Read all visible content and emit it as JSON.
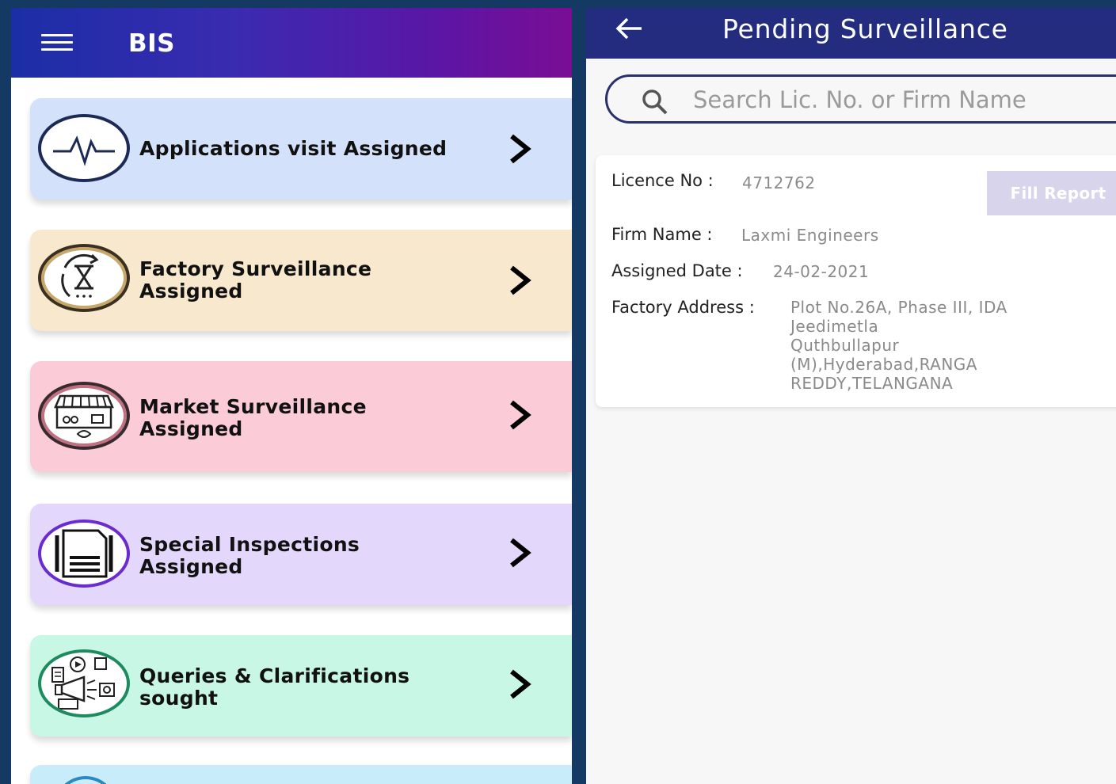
{
  "left_screen": {
    "header": {
      "title": "BIS",
      "menu_icon": "hamburger-menu-icon"
    },
    "menu_items": [
      {
        "label_line1": "Applications visit Assigned",
        "label_line2": "",
        "icon": "heartbeat-icon",
        "bg_color": "#d3e1fb",
        "ring_color": "#1c2a55"
      },
      {
        "label_line1": "Factory Surveillance",
        "label_line2": "Assigned",
        "icon": "hourglass-icon",
        "bg_color": "#f8e8cd",
        "ring_color": "#7a5a2a"
      },
      {
        "label_line1": "Market Surveillance",
        "label_line2": "Assigned",
        "icon": "market-stall-icon",
        "bg_color": "#fbccd8",
        "ring_color": "#7a2a3a"
      },
      {
        "label_line1": "Special Inspections",
        "label_line2": "Assigned",
        "icon": "document-icon",
        "bg_color": "#e3d7fb",
        "ring_color": "#6a2bd0"
      },
      {
        "label_line1": "Queries & Clarifications",
        "label_line2": "sought",
        "icon": "megaphone-media-icon",
        "bg_color": "#c9f7e6",
        "ring_color": "#1e8a60"
      }
    ],
    "chevron_icon": "chevron-right-icon"
  },
  "right_screen": {
    "header": {
      "title": "Pending Surveillance",
      "back_icon": "back-arrow-icon"
    },
    "search": {
      "placeholder": "Search Lic. No. or Firm Name",
      "value": "",
      "icon": "search-icon"
    },
    "licence_card": {
      "licence_no_label": "Licence No :",
      "licence_no": "4712762",
      "firm_name_label": "Firm Name :",
      "firm_name": "Laxmi Engineers",
      "assigned_date_label": "Assigned Date :",
      "assigned_date": "24-02-2021",
      "factory_address_label": "Factory Address :",
      "factory_address_lines": [
        "Plot No.26A, Phase III, IDA",
        "Jeedimetla",
        "Quthbullapur",
        "(M),Hyderabad,RANGA",
        "REDDY,TELANGANA"
      ],
      "fill_report_label": "Fill Report"
    }
  },
  "colors": {
    "frame": "#143a63",
    "right_header": "#232c7e",
    "left_header_start": "#1b2ea6",
    "left_header_end": "#7a0d94",
    "button_disabled": "#d8d4ec"
  }
}
